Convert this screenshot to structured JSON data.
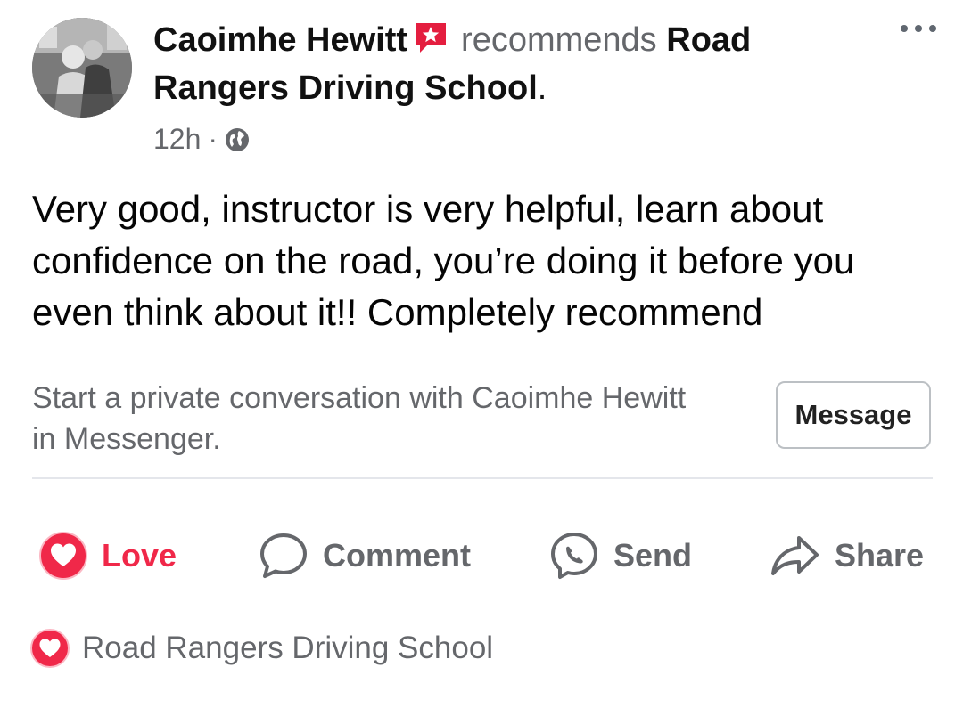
{
  "post": {
    "author": "Caoimhe Hewitt",
    "verb": "recommends",
    "page_name": "Road Rangers Driving School",
    "period": ".",
    "time": "12h",
    "separator": "·",
    "text": "Very good, instructor is very helpful, learn about confidence on the road, you’re doing it before you even think about it!! Completely recommend"
  },
  "cta": {
    "text": "Start a private conversation with Caoimhe Hewitt in Messenger.",
    "button_label": "Message"
  },
  "actions": {
    "love": "Love",
    "comment": "Comment",
    "send": "Send",
    "share": "Share"
  },
  "reactions": {
    "name": "Road Rangers Driving School"
  },
  "colors": {
    "love_red": "#f02849",
    "secondary_text": "#65676b",
    "badge_red": "#e41e3f"
  }
}
